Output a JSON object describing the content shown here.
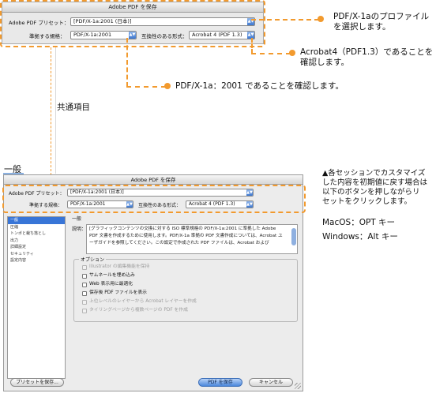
{
  "colors": {
    "accent_orange": "#f29a2e",
    "select_blue": "#3875d7"
  },
  "top_dialog": {
    "title": "Adobe PDF を保存",
    "preset_label": "Adobe PDF プリセット：",
    "preset_value": "[PDF/X-1a:2001 (日本)]",
    "standard_label": "準拠する規格：",
    "standard_value": "PDF/X-1a:2001",
    "compat_label": "互換性のある形式：",
    "compat_value": "Acrobat 4 (PDF 1.3)"
  },
  "callouts": {
    "preset_line1": "PDF/X-1aのプロファイル",
    "preset_line2": "を選択します。",
    "acrobat_line1": "Acrobat4（PDF1.3）であることを",
    "acrobat_line2": "確認します。",
    "standard": "PDF/X-1a：2001 であることを確認します。"
  },
  "section_common": "共通項目",
  "section_general": "一般",
  "reset_note": {
    "line1": "▲各セッションでカスタマイズ",
    "line2": "した内容を初期値に戻す場合は",
    "line3": "以下のボタンを押しながらリ",
    "line4": "セットをクリックします。",
    "mac": "MacOS：OPT キー",
    "win": "Windows：Alt キー"
  },
  "dialog": {
    "title": "Adobe PDF を保存",
    "preset_label": "Adobe PDF プリセット：",
    "preset_value": "[PDF/X-1a:2001 (日本)]",
    "standard_label": "準拠する規格：",
    "standard_value": "PDF/X-1a:2001",
    "compat_label": "互換性のある形式：",
    "compat_value": "Acrobat 4 (PDF 1.3)",
    "sidebar": [
      "一般",
      "圧縮",
      "トンボと裁ち落とし",
      "出力",
      "詳細設定",
      "セキュリティ",
      "設定内容"
    ],
    "group_general": "一般",
    "desc_label": "説明：",
    "description": "[グラフィックコンテンツの交換に対する ISO 標準規格の PDF/X-1a:2001 に準拠した Adobe PDF 文書を作成するために使用します。PDF/X-1a 準拠の PDF 文書作成については、Acrobat ユーザガイドを参照してください。この設定で作成された PDF ファイルは、Acrobat および",
    "options_label": "オプション",
    "options": [
      {
        "label": "Illustrator の編集機能を保持",
        "enabled": false
      },
      {
        "label": "サムネールを埋め込み",
        "enabled": true
      },
      {
        "label": "Web 表示用に最適化",
        "enabled": true
      },
      {
        "label": "保存後 PDF ファイルを表示",
        "enabled": true
      },
      {
        "label": "上位レベルのレイヤーから Acrobat レイヤーを作成",
        "enabled": false
      },
      {
        "label": "タイリングページから複数ページの PDF を作成",
        "enabled": false
      }
    ],
    "save_preset_button": "プリセットを保存...",
    "save_pdf_button": "PDF を保存",
    "cancel_button": "キャンセル"
  }
}
